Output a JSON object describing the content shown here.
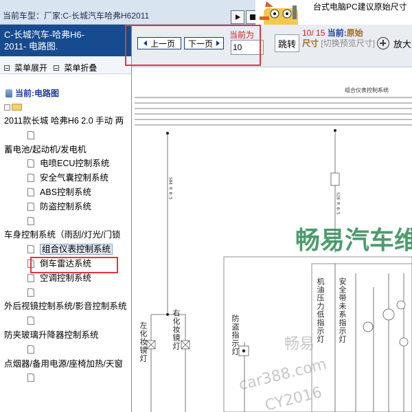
{
  "topbar": {
    "vehicle_label": "当前车型：",
    "vehicle_value": "厂家:C-长城汽车哈弗H62011"
  },
  "ad": {
    "text": "台式电脑PC建议原始尺寸"
  },
  "sidebar": {
    "header": [
      "C-长城汽车-哈弗H6-",
      "2011- 电路图."
    ],
    "expand_label": "菜单展开",
    "collapse_label": "菜单折叠",
    "current_label": "当前:电路图",
    "tree": [
      {
        "type": "group",
        "label": "2011款长城 哈弗H6 2.0 手动 两"
      },
      {
        "type": "doc",
        "label": ""
      },
      {
        "type": "group",
        "label": "蓄电池/起动机/发电机"
      },
      {
        "type": "leaf",
        "label": "电喷ECU控制系统"
      },
      {
        "type": "leaf",
        "label": "安全气囊控制系统"
      },
      {
        "type": "leaf",
        "label": "ABS控制系统"
      },
      {
        "type": "leaf",
        "label": "防盗控制系统"
      },
      {
        "type": "doc",
        "label": ""
      },
      {
        "type": "group",
        "label": "车身控制系统（雨刮/灯光/门锁"
      },
      {
        "type": "leaf",
        "label": "组合仪表控制系统",
        "selected": true
      },
      {
        "type": "leaf",
        "label": "倒车雷达系统"
      },
      {
        "type": "leaf",
        "label": "空调控制系统"
      },
      {
        "type": "doc",
        "label": ""
      },
      {
        "type": "group",
        "label": "外后视镜控制系统/影音控制系统"
      },
      {
        "type": "doc",
        "label": ""
      },
      {
        "type": "group",
        "label": "防夹玻璃升降器控制系统"
      },
      {
        "type": "doc",
        "label": ""
      },
      {
        "type": "group",
        "label": "点烟器/备用电源/座椅加热/天窗"
      },
      {
        "type": "doc",
        "label": ""
      }
    ]
  },
  "viewer": {
    "prev_label": "上一页",
    "next_label": "下一页",
    "current_label": "当前为",
    "page_value": "10",
    "jump_label": "跳转",
    "page_counter": "10/ 15",
    "current_prefix": "当前:",
    "size_value": "原始",
    "size_label": "尺寸",
    "switch_hint": "[切换预览尺寸]",
    "zoom_label": "放大"
  },
  "diagram": {
    "title": "组合仪表控制系统",
    "watermark_main": "畅易汽车维",
    "watermark_sub": [
      "畅易",
      "car388.com",
      "CY2016"
    ],
    "wire_labels": [
      "S04 R 0.5",
      "S28 R 0.5"
    ],
    "vertical_labels": [
      "左化妆镜灯",
      "右化妆镜灯",
      "防盗指示灯",
      "机油压力低指示灯",
      "安全带未系指示灯",
      "安全带指示灯",
      "燃油位置"
    ]
  }
}
